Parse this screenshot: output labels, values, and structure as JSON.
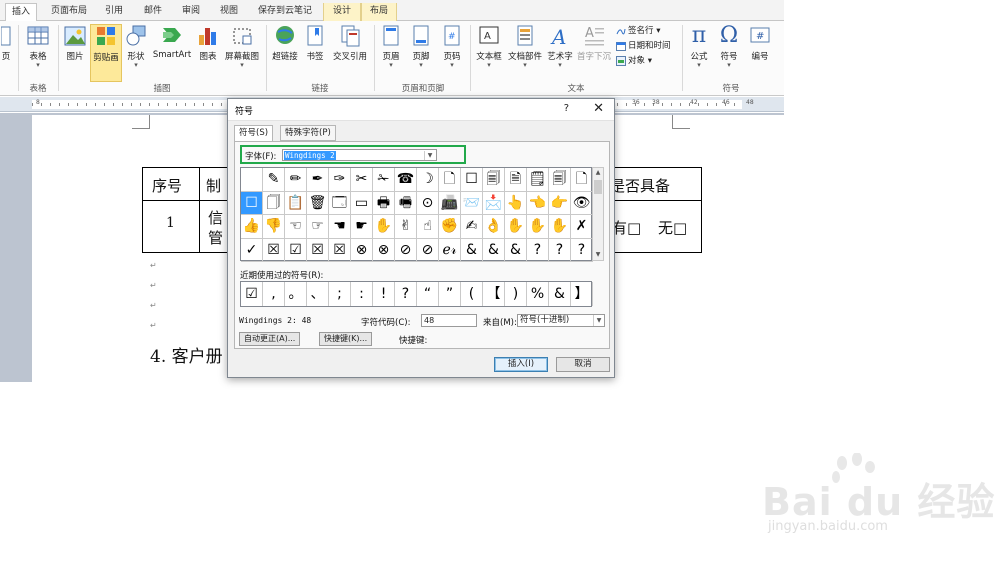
{
  "tabs": [
    "插入",
    "页面布局",
    "引用",
    "邮件",
    "审阅",
    "视图",
    "保存到云笔记",
    "设计",
    "布局"
  ],
  "ribbon": {
    "cut_left": "页",
    "buttons": {
      "table": "表格",
      "picture": "图片",
      "clipart": "剪贴画",
      "shapes": "形状",
      "smartart": "SmartArt",
      "chart": "图表",
      "screenshot": "屏幕截图",
      "hyperlink": "超链接",
      "bookmark": "书签",
      "crossref": "交叉引用",
      "header": "页眉",
      "footer": "页脚",
      "pagenum": "页码",
      "textbox": "文本框",
      "quickparts": "文档部件",
      "wordart": "艺术字",
      "dropcap": "首字下沉",
      "equation": "公式",
      "symbol": "符号",
      "number": "编号"
    },
    "small": {
      "signature": "签名行",
      "datetime": "日期和时间",
      "object": "对象"
    },
    "groups": {
      "tables": "表格",
      "illustrations": "插图",
      "links": "链接",
      "header_footer": "页眉和页脚",
      "text": "文本",
      "symbols": "符号"
    },
    "icons": {
      "symbol_glyph": "Ω",
      "equation_glyph": "π"
    }
  },
  "ruler": {
    "label1": "8",
    "label2": "36",
    "label3": "38",
    "label4": "42",
    "label5": "46",
    "label6": "48"
  },
  "document": {
    "col1": "序号",
    "col2": "制",
    "col3": "是否具备",
    "row_num": "1",
    "row_text_a": "信",
    "row_text_b": "管",
    "has": "有□",
    "none": "无□",
    "heading": "4. 客户册"
  },
  "dialog": {
    "title": "符号",
    "help": "?",
    "close": "✕",
    "tab_symbols": "符号(S)",
    "tab_special": "特殊字符(P)",
    "font_label": "字体(F):",
    "font_value": "Wingdings 2",
    "recent_label": "近期使用过的符号(R):",
    "char_name": "Wingdings 2: 48",
    "char_code_label": "字符代码(C):",
    "char_code": "48",
    "from_label": "来自(M):",
    "from_value": "符号(十进制)",
    "autocorrect": "自动更正(A)...",
    "shortcut_key_btn": "快捷键(K)...",
    "shortcut_key_label": "快捷键:",
    "insert": "插入(I)",
    "cancel": "取消"
  },
  "symbol_grid": [
    [
      "",
      "✎",
      "✏",
      "✒",
      "✑",
      "✂",
      "✁",
      "☎",
      "☽",
      "🗋",
      "☐",
      "🗐",
      "🗎",
      "🗒",
      "🗐",
      "🗋"
    ],
    [
      "☐",
      "🗍",
      "📋",
      "🗑",
      "🗔",
      "▭",
      "🖶",
      "🖷",
      "⊙",
      "📠",
      "📨",
      "📩",
      "👆",
      "👈",
      "👉",
      "👁"
    ],
    [
      "👍",
      "👎",
      "☜",
      "☞",
      "☚",
      "☛",
      "✋",
      "✌",
      "☝",
      "✊",
      "✍",
      "👌",
      "✋",
      "✋",
      "✋",
      "✗"
    ],
    [
      "✓",
      "☒",
      "☑",
      "☒",
      "☒",
      "⊗",
      "⊗",
      "⊘",
      "⊘",
      "ℯ𝓇",
      "&",
      "&",
      "&",
      "?",
      "?",
      "?"
    ]
  ],
  "recent_symbols": [
    "☑",
    ",",
    "。",
    "、",
    ";",
    ":",
    "!",
    "?",
    "“",
    "”",
    "(",
    "【",
    ")",
    "%",
    "&",
    "】"
  ],
  "watermark": {
    "brand": "Bai du 经验",
    "url": "jingyan.baidu.com"
  },
  "colors": {
    "highlight_border": "#22a94b",
    "selection": "#3399ff",
    "active_ribbon": "#fde99a"
  }
}
